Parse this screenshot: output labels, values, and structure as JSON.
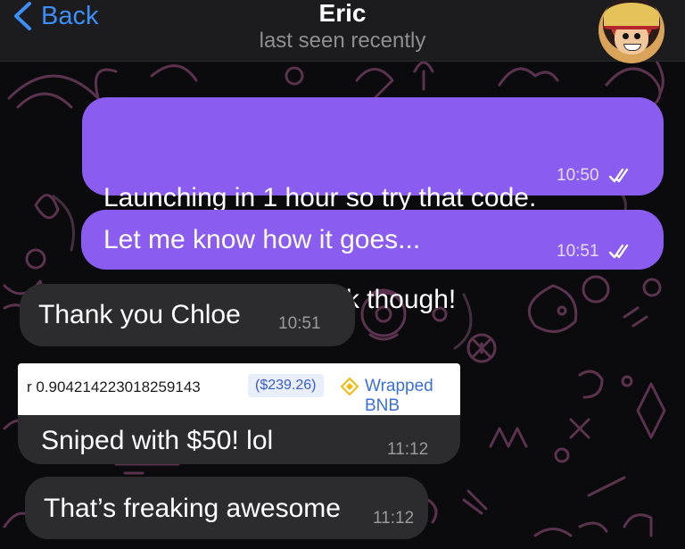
{
  "header": {
    "back_label": "Back",
    "contact_name": "Eric",
    "status": "last seen recently"
  },
  "messages": [
    {
      "direction": "outgoing",
      "lines": [
        "Launching in 1 hour so try that code.",
        "That one should work though!"
      ],
      "time": "10:50",
      "read": true
    },
    {
      "direction": "outgoing",
      "lines": [
        "Let me know how it goes..."
      ],
      "time": "10:51",
      "read": true
    },
    {
      "direction": "incoming",
      "lines": [
        "Thank you Chloe"
      ],
      "time": "10:51"
    },
    {
      "direction": "incoming",
      "lines": [
        "Sniped with $50! lol"
      ],
      "time": "11:12",
      "preview": {
        "amount": "r 0.904214223018259143",
        "usd": "($239.26)",
        "token": "Wrapped BNB",
        "token_icon": "bnb-diamond-icon"
      }
    },
    {
      "direction": "incoming",
      "lines": [
        "That’s freaking awesome"
      ],
      "time": "11:12"
    }
  ],
  "colors": {
    "outgoing_bubble": "#8a5cf0",
    "incoming_bubble": "#2c2c2f",
    "accent": "#3e8ef7",
    "background": "#0b0b0d"
  }
}
